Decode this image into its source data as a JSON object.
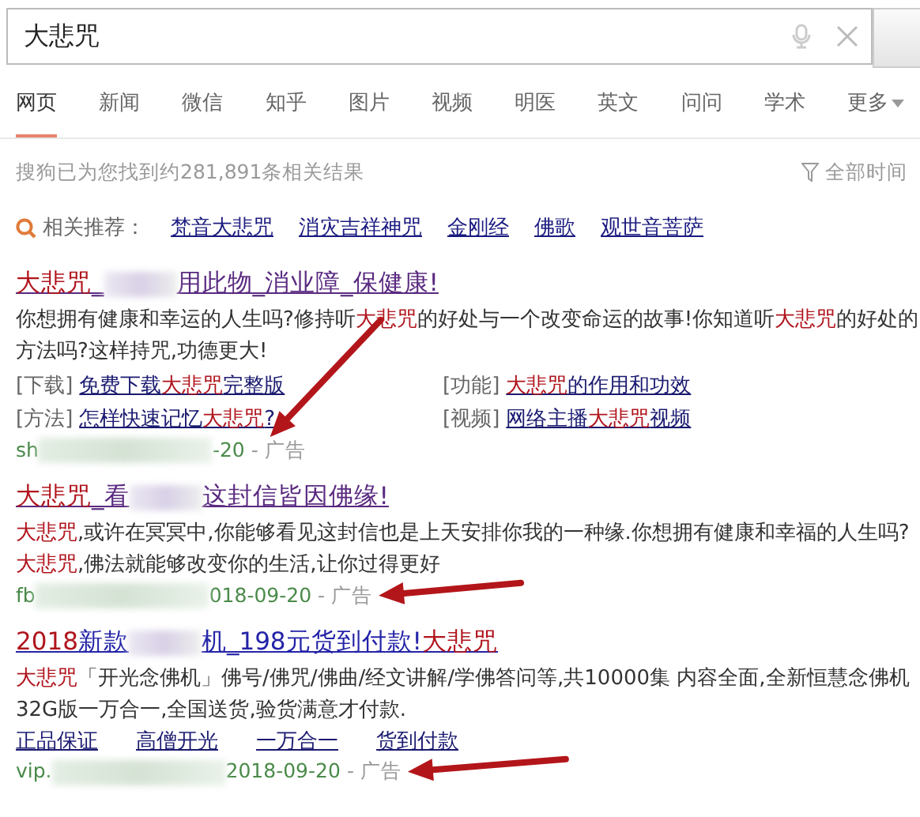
{
  "search": {
    "value": "大悲咒"
  },
  "tabs": [
    {
      "label": "网页",
      "selected": true
    },
    {
      "label": "新闻",
      "selected": false
    },
    {
      "label": "微信",
      "selected": false
    },
    {
      "label": "知乎",
      "selected": false
    },
    {
      "label": "图片",
      "selected": false
    },
    {
      "label": "视频",
      "selected": false
    },
    {
      "label": "明医",
      "selected": false
    },
    {
      "label": "英文",
      "selected": false
    },
    {
      "label": "问问",
      "selected": false
    },
    {
      "label": "学术",
      "selected": false
    },
    {
      "label": "更多",
      "selected": false,
      "kind": "dropdown"
    }
  ],
  "result_count": "搜狗已为您找到约281,891条相关结果",
  "time_filter": "全部时间",
  "related": {
    "label": "相关推荐：",
    "items": [
      "梵音大悲咒",
      "消灾吉祥神咒",
      "金刚经",
      "佛歌",
      "观世音菩萨"
    ]
  },
  "results": [
    {
      "visited": true,
      "marked": true,
      "title": [
        {
          "text": "大悲咒",
          "highlight": true
        },
        {
          "text": "_"
        },
        {
          "kind": "blur"
        },
        {
          "text": "用此物_消业障_保健康!"
        }
      ],
      "description": [
        {
          "text": "你想拥有健康和幸运的人生吗?修持听"
        },
        {
          "text": "大悲咒",
          "highlight": true
        },
        {
          "text": "的好处与一个改变命运的故事!你知道听"
        },
        {
          "text": "大悲咒",
          "highlight": true
        },
        {
          "text": "的好处的方法吗?这样持咒,功德更大!"
        }
      ],
      "sublinks": [
        {
          "tag": "[下载]",
          "link": [
            {
              "text": "免费下载"
            },
            {
              "text": "大悲咒",
              "highlight": true
            },
            {
              "text": "完整版"
            }
          ]
        },
        {
          "tag": "[功能]",
          "link": [
            {
              "text": "大悲咒",
              "highlight": true
            },
            {
              "text": "的作用和功效"
            }
          ]
        },
        {
          "tag": "[方法]",
          "link": [
            {
              "text": "怎样快速记忆"
            },
            {
              "text": "大悲咒",
              "highlight": true
            },
            {
              "text": "?"
            }
          ]
        },
        {
          "tag": "[视频]",
          "link": [
            {
              "text": "网络主播"
            },
            {
              "text": "大悲咒",
              "highlight": true
            },
            {
              "text": "视频"
            }
          ]
        }
      ],
      "url": [
        {
          "text": "sh"
        },
        {
          "kind": "blur"
        },
        {
          "text": "-20"
        }
      ],
      "ad_label": "- 广告"
    },
    {
      "visited": true,
      "marked": true,
      "title": [
        {
          "text": "大悲咒",
          "highlight": true
        },
        {
          "text": "_看"
        },
        {
          "kind": "blur"
        },
        {
          "text": "这封信皆因佛缘!"
        }
      ],
      "description": [
        {
          "text": "大悲咒",
          "highlight": true
        },
        {
          "text": ",或许在冥冥中,你能够看见这封信也是上天安排你我的一种缘.你想拥有健康和幸福的人生吗?"
        },
        {
          "text": "大悲咒",
          "highlight": true
        },
        {
          "text": ",佛法就能够改变你的生活,让你过得更好"
        }
      ],
      "url": [
        {
          "text": "fb"
        },
        {
          "kind": "blur"
        },
        {
          "text": "018-09-20"
        }
      ],
      "ad_label": "- 广告"
    },
    {
      "visited": false,
      "marked": true,
      "title": [
        {
          "text": "2018",
          "highlight": true
        },
        {
          "text": "新款"
        },
        {
          "kind": "blur"
        },
        {
          "text": "机_198元货到付款!"
        },
        {
          "text": "大悲咒",
          "highlight": true
        }
      ],
      "description": [
        {
          "text": "大悲咒",
          "highlight": true
        },
        {
          "text": "「开光念佛机」佛号/佛咒/佛曲/经文讲解/学佛答问等,共10000集 内容全面,全新恒慧念佛机32G版一万合一,全国送货,验货满意才付款."
        }
      ],
      "links": [
        "正品保证",
        "高僧开光",
        "一万合一",
        "货到付款"
      ],
      "url": [
        {
          "text": "vip."
        },
        {
          "kind": "blur"
        },
        {
          "text": "2018-09-20"
        }
      ],
      "ad_label": "- 广告"
    }
  ]
}
